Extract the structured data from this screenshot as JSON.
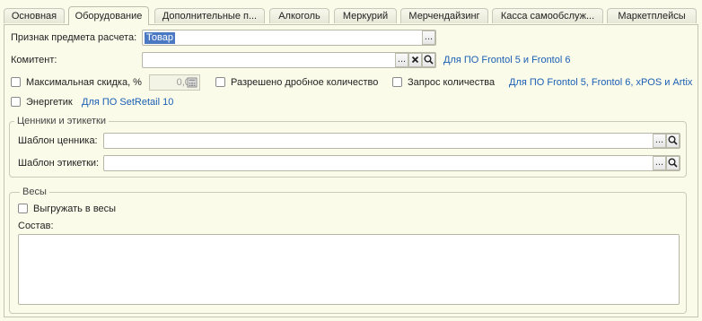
{
  "tabs": [
    {
      "label": "Основная"
    },
    {
      "label": "Оборудование"
    },
    {
      "label": "Дополнительные п..."
    },
    {
      "label": "Алкоголь"
    },
    {
      "label": "Меркурий"
    },
    {
      "label": "Мерчендайзинг"
    },
    {
      "label": "Касса самообслуж..."
    },
    {
      "label": "Маркетплейсы"
    }
  ],
  "active_tab": "Оборудование",
  "form": {
    "payment_subject_label": "Признак предмета расчета:",
    "payment_subject_value": "Товар",
    "committent_label": "Комитент:",
    "committent_value": "",
    "frontol_link": "Для ПО Frontol 5 и Frontol 6",
    "max_discount_label": "Максимальная скидка, %",
    "max_discount_value": "0,00",
    "fractional_label": "Разрешено дробное количество",
    "quantity_request_label": "Запрос количества",
    "frontol_xpos_link": "Для ПО Frontol 5, Frontol 6, xPOS и Artix",
    "energetic_label": "Энергетик",
    "setretail_link": "Для ПО SetRetail 10"
  },
  "price_tags": {
    "group_title": "Ценники и этикетки",
    "price_tag_label": "Шаблон ценника:",
    "label_template_label": "Шаблон этикетки:"
  },
  "scales": {
    "group_title": "Весы",
    "upload_label": "Выгружать в весы",
    "composition_label": "Состав:"
  },
  "icons": {
    "more": "...",
    "clear": "✕",
    "search": "search-icon",
    "calc": "calculator-icon"
  },
  "colors": {
    "background": "#fbfbea",
    "link": "#1a5fb4",
    "selection": "#4a78c2"
  }
}
